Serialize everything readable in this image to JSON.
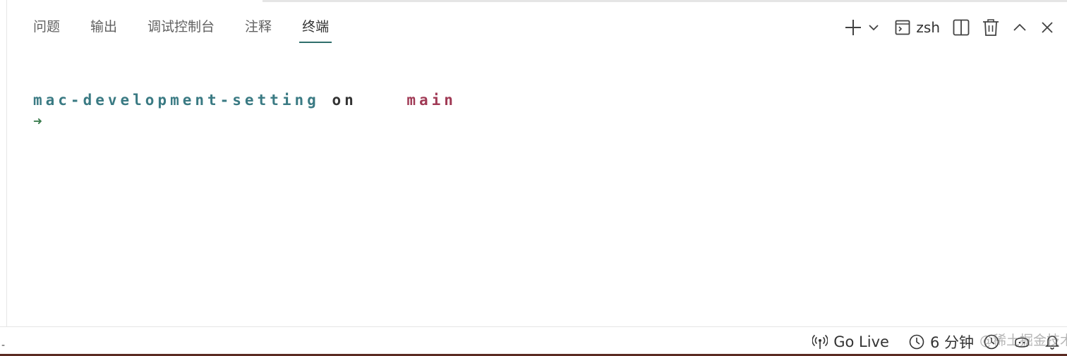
{
  "panel": {
    "tabs": [
      {
        "label": "问题",
        "active": false
      },
      {
        "label": "输出",
        "active": false
      },
      {
        "label": "调试控制台",
        "active": false
      },
      {
        "label": "注释",
        "active": false
      },
      {
        "label": "终端",
        "active": true
      }
    ],
    "actions": {
      "new_terminal_icon": "plus-icon",
      "dropdown_icon": "chevron-down-icon",
      "shell_icon": "terminal-icon",
      "shell_label": "zsh",
      "split_icon": "split-editor-icon",
      "kill_icon": "trash-icon",
      "maximize_icon": "chevron-up-icon",
      "close_icon": "close-icon"
    }
  },
  "terminal": {
    "directory": "mac-development-setting",
    "on_word": "on",
    "branch": "main",
    "prompt_symbol": "➜",
    "colors": {
      "directory": "#3a7a83",
      "branch": "#a03a55",
      "prompt": "#3c7d4f"
    }
  },
  "statusbar": {
    "left_mark": "-",
    "go_live_icon": "broadcast-icon",
    "go_live_label": "Go Live",
    "timer_icon": "clock-icon",
    "timer_label": "6 分钟",
    "watermark_text": "@稀土掘金技术社区",
    "extra_icons": [
      "clock-icon",
      "copilot-icon",
      "bell-icon"
    ]
  },
  "colors": {
    "accent": "#2f6f6c",
    "bottom_border": "#5a2a22"
  }
}
